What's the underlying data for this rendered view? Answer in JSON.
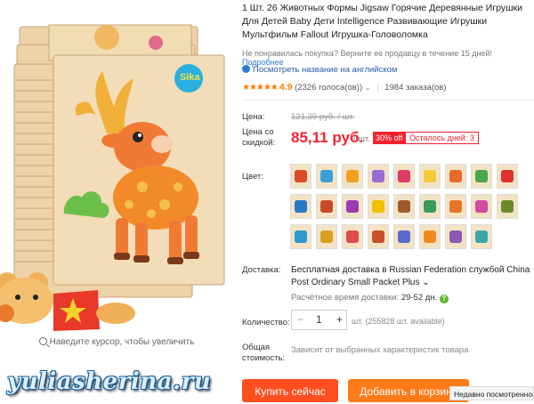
{
  "product": {
    "title": "1 Шт. 26 Животных Формы Jigsaw Горячие Деревянные Игрушки Для Детей Baby Дети Intelligence Развивающие Игрушки Мультфильм Fallout Игрушка-Головоломка",
    "guarantee_text": "Не понравилась покупка? Верните ее продавцу в течение 15 дней!",
    "guarantee_link": "Подробнее",
    "translate_link": "Посмотреть название на английском",
    "stars": "★★★★★",
    "rating": "4.9",
    "votes": "(2326 голоса(ов))",
    "orders": "1984 заказа(ов)"
  },
  "gallery": {
    "badge": "Sika",
    "zoom_hint": "Наведите курсор, чтобы увеличить"
  },
  "price": {
    "label": "Цена:",
    "old": "121,39 руб. / шт.",
    "discount_label": "Цена со скидкой:",
    "new": "85,11 руб.",
    "per_unit": "/ шт.",
    "discount": "30% off",
    "days_left": "Осталось дней: 3"
  },
  "color": {
    "label": "Цвет:",
    "swatch_colors": [
      "#d94a2a",
      "#3aa0d8",
      "#f0a020",
      "#9a6bd0",
      "#e03a6a",
      "#f6c93a",
      "#e86a2a",
      "#4aa84a",
      "#e0302a",
      "#2a78c8",
      "#c84a2a",
      "#9a3ab0",
      "#f0c000",
      "#a05a2a",
      "#3a9a5a",
      "#e8742a",
      "#d04aa0",
      "#6a8a2a",
      "#2a9ad0",
      "#d8a020",
      "#e04a4a",
      "#c8502a",
      "#5a6ad0",
      "#f08a20",
      "#8a5ab0",
      "#3aa8a8"
    ]
  },
  "shipping": {
    "label": "Доставка:",
    "text": "Бесплатная доставка в Russian Federation службой China Post Ordinary Small Packet Plus",
    "chevron": "⌄",
    "time_label": "Расчётное время доставки:",
    "time_value": "29-52 дн.",
    "help": "?"
  },
  "quantity": {
    "label": "Количество:",
    "minus": "−",
    "value": "1",
    "plus": "+",
    "available": "шт. (255828 шт. available)"
  },
  "total": {
    "label": "Общая стоимость:",
    "value": "Зависит от выбранных характеристик товара"
  },
  "buttons": {
    "buy": "Купить сейчас",
    "cart": "Добавить в корзину"
  },
  "watermark": "yuliasherina.ru",
  "recent_tab": "Недавно посмотренное"
}
